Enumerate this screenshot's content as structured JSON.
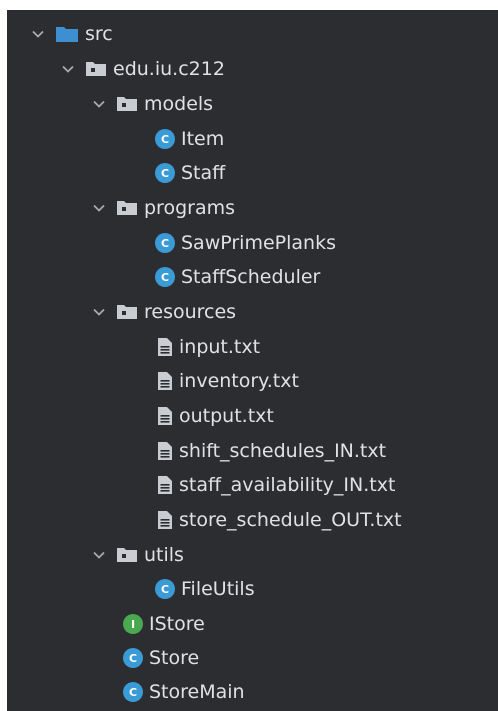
{
  "tree": {
    "src": {
      "label": "src",
      "icon": "blue-folder-icon"
    },
    "package": {
      "label": "edu.iu.c212",
      "icon": "package-folder-icon"
    },
    "models": {
      "label": "models",
      "items": [
        {
          "label": "Item",
          "icon": "class-icon",
          "badge": "C"
        },
        {
          "label": "Staff",
          "icon": "class-icon",
          "badge": "C"
        }
      ]
    },
    "programs": {
      "label": "programs",
      "items": [
        {
          "label": "SawPrimePlanks",
          "icon": "class-icon",
          "badge": "C"
        },
        {
          "label": "StaffScheduler",
          "icon": "class-icon",
          "badge": "C"
        }
      ]
    },
    "resources": {
      "label": "resources",
      "items": [
        {
          "label": "input.txt",
          "icon": "text-file-icon"
        },
        {
          "label": "inventory.txt",
          "icon": "text-file-icon"
        },
        {
          "label": "output.txt",
          "icon": "text-file-icon"
        },
        {
          "label": "shift_schedules_IN.txt",
          "icon": "text-file-icon"
        },
        {
          "label": "staff_availability_IN.txt",
          "icon": "text-file-icon"
        },
        {
          "label": "store_schedule_OUT.txt",
          "icon": "text-file-icon"
        }
      ]
    },
    "utils": {
      "label": "utils",
      "items": [
        {
          "label": "FileUtils",
          "icon": "class-icon",
          "badge": "C"
        }
      ]
    },
    "root_items": [
      {
        "label": "IStore",
        "icon": "interface-icon",
        "badge": "I"
      },
      {
        "label": "Store",
        "icon": "class-icon",
        "badge": "C"
      },
      {
        "label": "StoreMain",
        "icon": "class-icon",
        "badge": "C"
      }
    ]
  },
  "colors": {
    "background": "#2b2d30",
    "text": "#dfe1e5",
    "class_badge": "#3a9bd6",
    "interface_badge": "#4aa84e",
    "folder_blue": "#3d8fd1",
    "folder_gray": "#c9ccd1"
  }
}
